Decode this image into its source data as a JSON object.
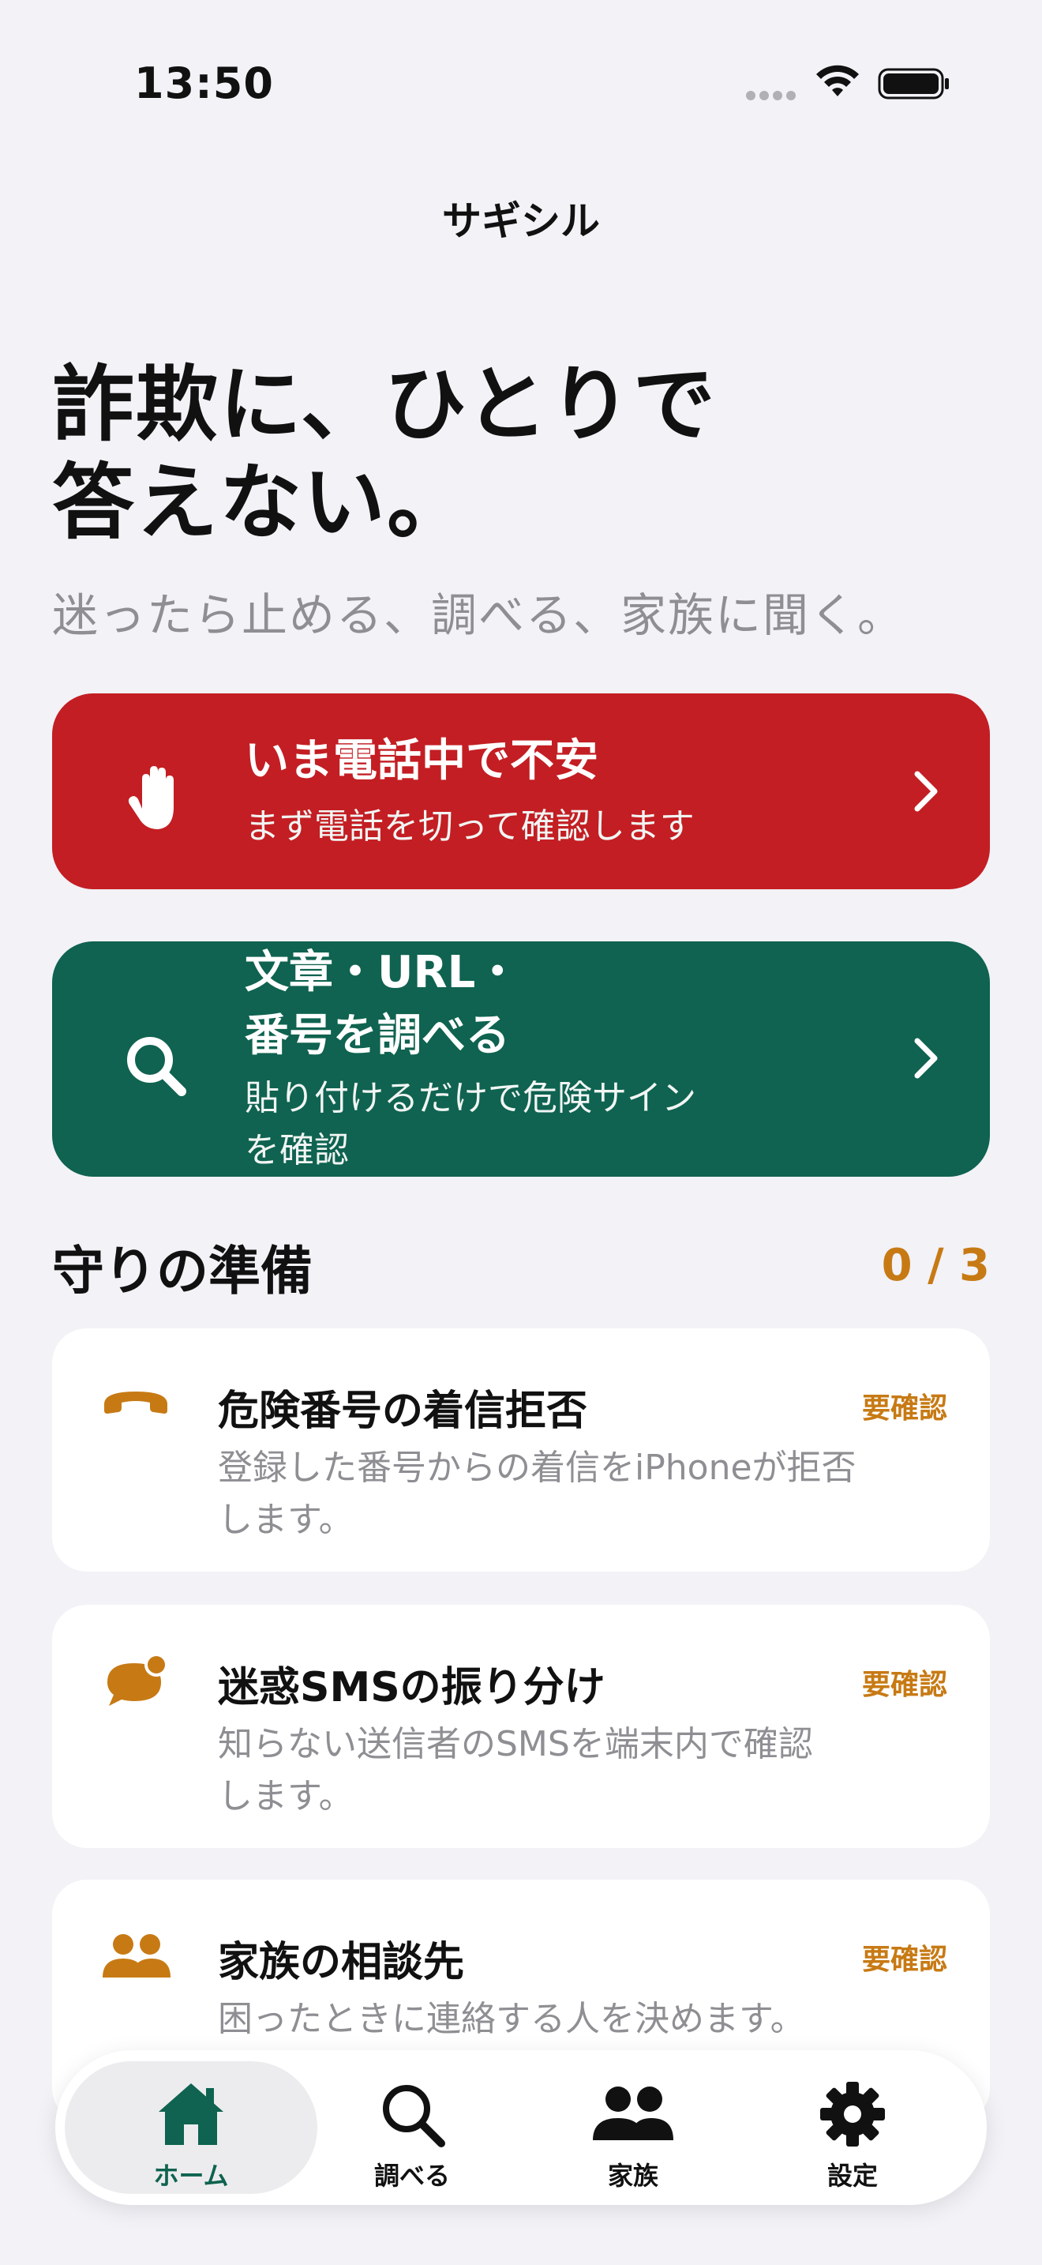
{
  "status_bar": {
    "time": "13:50"
  },
  "nav": {
    "title": "サギシル"
  },
  "hero": {
    "title_line1": "詐欺に、ひとりで",
    "title_line2": "答えない。",
    "subtitle": "迷ったら止める、調べる、家族に聞く。"
  },
  "actions": [
    {
      "title": "いま電話中で不安",
      "description": "まず電話を切って確認します",
      "icon": "hand-stop-icon",
      "color": "#c31e23"
    },
    {
      "title_line1": "文章・URL・",
      "title_line2": "番号を調べる",
      "description_line1": "貼り付けるだけで危険サイン",
      "description_line2": "を確認",
      "icon": "search-icon",
      "color": "#0f6350"
    }
  ],
  "preparation": {
    "title": "守りの準備",
    "progress": "0 / 3",
    "accent_color": "#c77a14",
    "items": [
      {
        "icon": "phone-down-icon",
        "title": "危険番号の着信拒否",
        "badge": "要確認",
        "desc_line1": "登録した番号からの着信をiPhoneが拒否",
        "desc_line2": "します。"
      },
      {
        "icon": "message-bubble-icon",
        "title": "迷惑SMSの振り分け",
        "badge": "要確認",
        "desc_line1": "知らない送信者のSMSを端末内で確認",
        "desc_line2": "します。"
      },
      {
        "icon": "people-icon",
        "title": "家族の相談先",
        "badge": "要確認",
        "desc_line1": "困ったときに連絡する人を決めます。"
      }
    ]
  },
  "tabs": [
    {
      "label": "ホーム",
      "icon": "house-icon",
      "selected": true
    },
    {
      "label": "調べる",
      "icon": "search-icon",
      "selected": false
    },
    {
      "label": "家族",
      "icon": "people-icon",
      "selected": false
    },
    {
      "label": "設定",
      "icon": "gear-icon",
      "selected": false
    }
  ],
  "colors": {
    "background": "#f2f2f7",
    "selected_tab": "#0f6350"
  }
}
